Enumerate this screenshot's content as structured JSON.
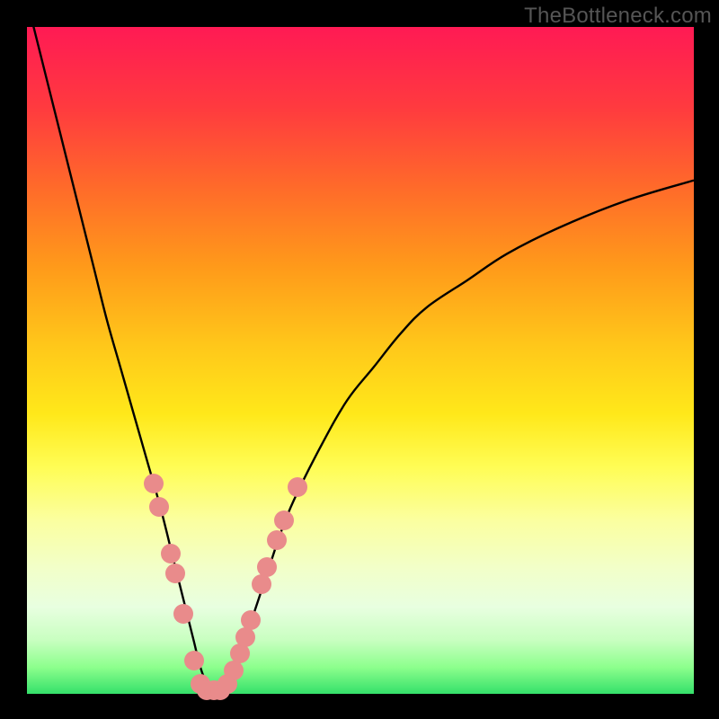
{
  "watermark": "TheBottleneck.com",
  "colors": {
    "background": "#000000",
    "marker": "#e98b8b",
    "curve": "#000000",
    "gradient_top": "#ff1a54",
    "gradient_bottom": "#34e06a"
  },
  "chart_data": {
    "type": "line",
    "title": "",
    "xlabel": "",
    "ylabel": "",
    "xlim": [
      0,
      100
    ],
    "ylim": [
      0,
      100
    ],
    "grid": false,
    "legend": false,
    "series": [
      {
        "name": "bottleneck-curve",
        "x": [
          0,
          2,
          4,
          6,
          8,
          10,
          12,
          14,
          16,
          18,
          20,
          22,
          24,
          25,
          26,
          27,
          28,
          29,
          30,
          32,
          34,
          36,
          38,
          40,
          44,
          48,
          52,
          56,
          60,
          66,
          72,
          80,
          90,
          100
        ],
        "y": [
          104,
          96,
          88,
          80,
          72,
          64,
          56,
          49,
          42,
          35,
          28,
          20,
          12,
          8,
          4,
          1.5,
          0.5,
          0.5,
          1.5,
          6,
          12,
          18,
          24,
          29,
          37,
          44,
          49,
          54,
          58,
          62,
          66,
          70,
          74,
          77
        ]
      }
    ],
    "markers": {
      "name": "highlighted-points",
      "points_xy": [
        [
          19.0,
          31.5
        ],
        [
          19.8,
          28.0
        ],
        [
          21.5,
          21.0
        ],
        [
          22.2,
          18.0
        ],
        [
          23.5,
          12.0
        ],
        [
          25.0,
          5.0
        ],
        [
          26.0,
          1.5
        ],
        [
          27.0,
          0.5
        ],
        [
          28.0,
          0.5
        ],
        [
          29.0,
          0.5
        ],
        [
          30.0,
          1.5
        ],
        [
          31.0,
          3.5
        ],
        [
          32.0,
          6.0
        ],
        [
          32.8,
          8.5
        ],
        [
          33.5,
          11.0
        ],
        [
          35.2,
          16.5
        ],
        [
          36.0,
          19.0
        ],
        [
          37.5,
          23.0
        ],
        [
          38.5,
          26.0
        ],
        [
          40.5,
          31.0
        ]
      ]
    }
  }
}
